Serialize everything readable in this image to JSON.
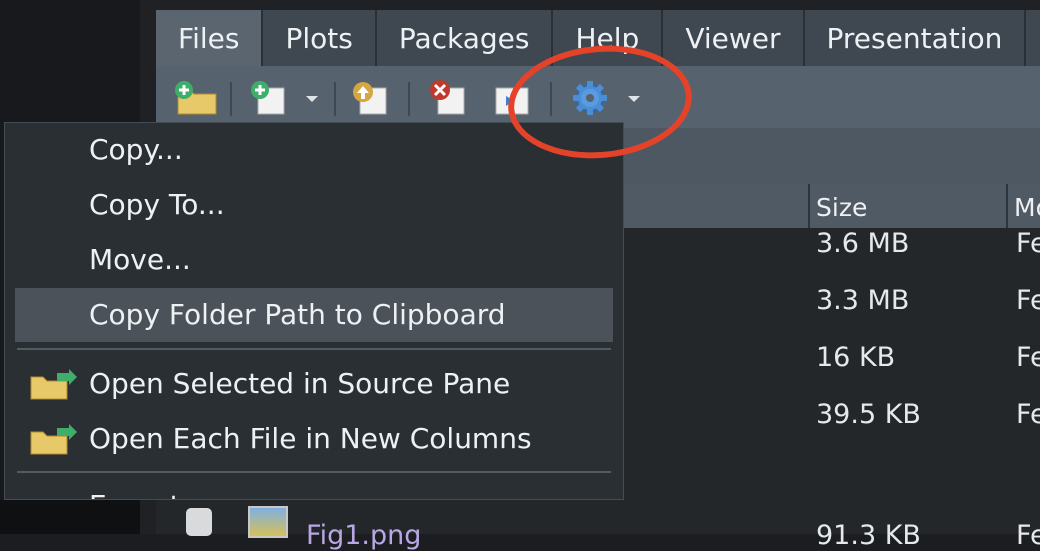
{
  "tabs": [
    "Files",
    "Plots",
    "Packages",
    "Help",
    "Viewer",
    "Presentation"
  ],
  "toolbar": {
    "icons": [
      "new-folder-icon",
      "new-blank-file-icon",
      "dropdown-arrow-icon",
      "upload-icon",
      "delete-icon",
      "rename-icon",
      "gear-icon",
      "dropdown-arrow-icon"
    ]
  },
  "table": {
    "headers": {
      "size": "Size",
      "modified": "Mo"
    },
    "rows": [
      {
        "size": "3.6 MB",
        "modified": "Fe"
      },
      {
        "size": "3.3 MB",
        "modified": "Fe"
      },
      {
        "size": "16 KB",
        "modified": "Fe"
      },
      {
        "size": "39.5 KB",
        "modified": "Fe"
      },
      {
        "name": "Fig1.png",
        "size": "91.3 KB",
        "modified": "Fe"
      }
    ]
  },
  "menu": {
    "items": [
      "Copy...",
      "Copy To...",
      "Move...",
      "Copy Folder Path to Clipboard",
      "Open Selected in Source Pane",
      "Open Each File in New Columns",
      "Export..."
    ],
    "highlighted_index": 3
  },
  "colors": {
    "annotation": "#e4432a",
    "accent_link": "#b7a7e4"
  }
}
